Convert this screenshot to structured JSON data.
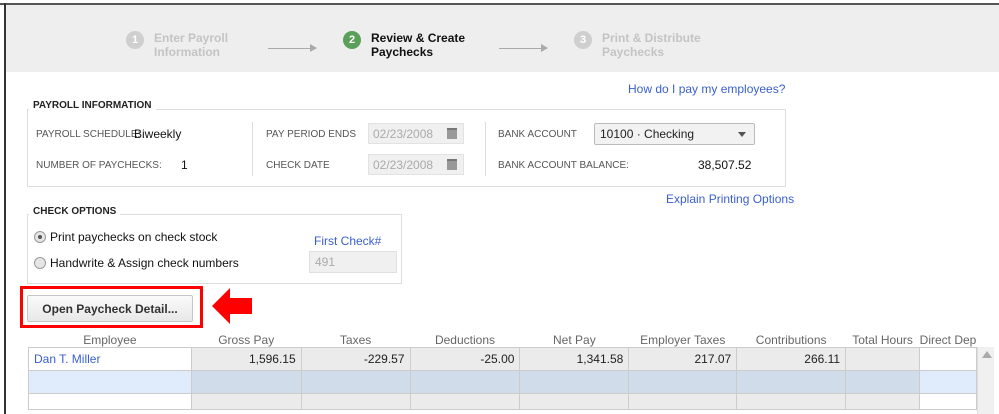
{
  "wizard": {
    "steps": [
      {
        "num": "1",
        "line1": "Enter Payroll",
        "line2": "Information",
        "state": "done"
      },
      {
        "num": "2",
        "line1": "Review & Create",
        "line2": "Paychecks",
        "state": "active"
      },
      {
        "num": "3",
        "line1": "Print & Distribute",
        "line2": "Paychecks",
        "state": "pending"
      }
    ]
  },
  "help_link": "How do I pay my employees?",
  "payroll_info": {
    "title": "PAYROLL INFORMATION",
    "schedule_label": "PAYROLL SCHEDULE:",
    "schedule_value": "Biweekly",
    "num_label": "NUMBER OF PAYCHECKS:",
    "num_value": "1",
    "period_label": "PAY PERIOD ENDS",
    "period_value": "02/23/2008",
    "check_date_label": "CHECK DATE",
    "check_date_value": "02/23/2008",
    "bank_label": "BANK ACCOUNT",
    "bank_value": "10100 · Checking",
    "balance_label": "BANK ACCOUNT BALANCE:",
    "balance_value": "38,507.52"
  },
  "explain_link": "Explain Printing Options",
  "check_options": {
    "title": "CHECK OPTIONS",
    "option1": "Print paychecks on check stock",
    "option2": "Handwrite & Assign check numbers",
    "first_check_label": "First Check#",
    "first_check_value": "491",
    "selected": "option1"
  },
  "open_detail_button": "Open Paycheck Detail...",
  "annotation_color": "#ff0000",
  "table": {
    "columns": [
      "Employee",
      "Gross Pay",
      "Taxes",
      "Deductions",
      "Net Pay",
      "Employer Taxes",
      "Contributions",
      "Total Hours",
      "Direct Dep"
    ],
    "rows": [
      [
        "Dan T. Miller",
        "1,596.15",
        "-229.57",
        "-25.00",
        "1,341.58",
        "217.07",
        "266.11",
        "",
        ""
      ]
    ]
  }
}
